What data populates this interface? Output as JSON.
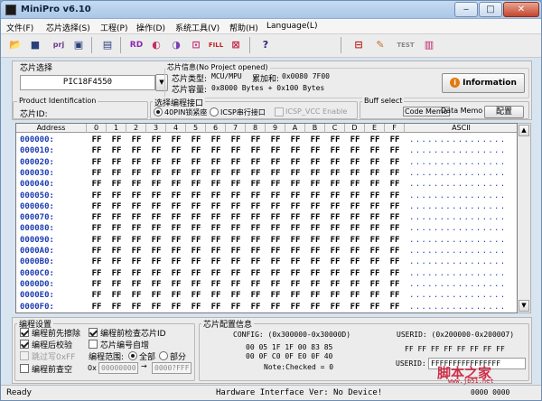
{
  "window": {
    "title": "MiniPro v6.10"
  },
  "menu": [
    "文件(F)",
    "芯片选择(S)",
    "工程(P)",
    "操作(D)",
    "系统工具(V)",
    "帮助(H)",
    "Language(L)"
  ],
  "chip_select": {
    "label": "芯片选择",
    "value": "PIC18F4550"
  },
  "chip_info": {
    "title": "芯片信息(No Project opened)",
    "type_label": "芯片类型:",
    "type_value": "MCU/MPU",
    "checksum_label": "累加和:",
    "checksum_value": "0x0080 7F00",
    "capacity_label": "芯片容量:",
    "capacity_value": "0x8000 Bytes + 0x100 Bytes",
    "info_button": "Information"
  },
  "product": {
    "title": "Product Identification",
    "chip_id_label": "芯片ID:"
  },
  "prog_interface": {
    "title": "选择编程接口",
    "opt1": "40PIN锁紧座",
    "opt2": "ICSP串行接口",
    "opt3": "ICSP_VCC Enable"
  },
  "buff": {
    "title": "Buff select",
    "code_memo": "Code Memo",
    "data_memo": "Data Memo",
    "config_button": "配置"
  },
  "grid": {
    "columns": [
      "Address",
      "0",
      "1",
      "2",
      "3",
      "4",
      "5",
      "6",
      "7",
      "8",
      "9",
      "A",
      "B",
      "C",
      "D",
      "E",
      "F",
      "ASCII"
    ],
    "rows": [
      {
        "addr": "000000:",
        "ascii": "................"
      },
      {
        "addr": "000010:",
        "ascii": "................"
      },
      {
        "addr": "000020:",
        "ascii": "................"
      },
      {
        "addr": "000030:",
        "ascii": "................"
      },
      {
        "addr": "000040:",
        "ascii": "................"
      },
      {
        "addr": "000050:",
        "ascii": "................"
      },
      {
        "addr": "000060:",
        "ascii": "................"
      },
      {
        "addr": "000070:",
        "ascii": "................"
      },
      {
        "addr": "000080:",
        "ascii": "................"
      },
      {
        "addr": "000090:",
        "ascii": "................"
      },
      {
        "addr": "0000A0:",
        "ascii": "................"
      },
      {
        "addr": "0000B0:",
        "ascii": "................"
      },
      {
        "addr": "0000C0:",
        "ascii": "................"
      },
      {
        "addr": "0000D0:",
        "ascii": "................"
      },
      {
        "addr": "0000E0:",
        "ascii": "................"
      },
      {
        "addr": "0000F0:",
        "ascii": "................"
      }
    ],
    "fill": "FF"
  },
  "settings": {
    "title": "编程设置",
    "erase": "编程前先擦除",
    "verify": "编程后校验",
    "skip_ff": "跳过写0xFF",
    "check_blank": "编程前查空",
    "check_id": "编程前检查芯片ID",
    "auto_inc": "芯片编号自增",
    "range_label": "编程范围:",
    "all": "全部",
    "part": "部分",
    "from_prefix": "0x",
    "from_value": "00000000",
    "to_value": "0000?FFF"
  },
  "config": {
    "title": "芯片配置信息",
    "config_label": "CONFIG: (0x300000-0x30000D)",
    "config_line1": "00 05 1F 1F 00 83 85",
    "config_line2": "00 0F C0 0F E0 0F 40",
    "note": "Note:Checked = 0",
    "userid_label": "USERID: (0x200000-0x200007)",
    "userid_line": "FF FF FF FF FF FF FF FF",
    "userid_field_label": "USERID:",
    "userid_value": "FFFFFFFFFFFFFFFF"
  },
  "status": {
    "ready": "Ready",
    "hardware": "Hardware Interface Ver: No Device!",
    "counter": "0000 0000"
  },
  "watermark": {
    "text": "脚本之家",
    "url": "www.jb51.net"
  }
}
